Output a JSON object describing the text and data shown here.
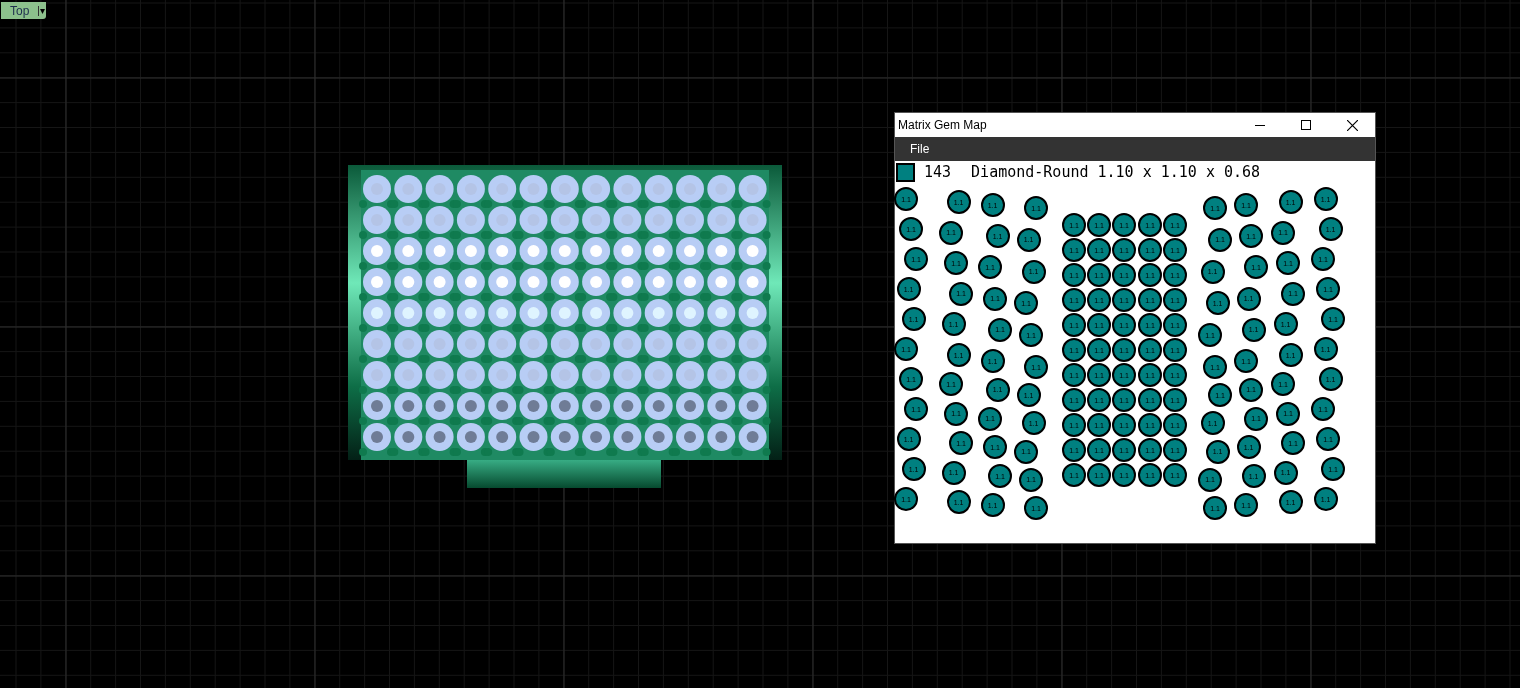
{
  "viewport": {
    "view_menu": {
      "label": "Top",
      "arrow": "▾"
    }
  },
  "window": {
    "title": "Matrix Gem Map",
    "menu": [
      "File"
    ],
    "legend": [
      {
        "color": "#008080",
        "count": "143",
        "label": "Diamond-Round 1.10 x 1.10 x 0.68"
      }
    ],
    "gems": [
      "1.1",
      "1.1",
      "1.1",
      "1.1",
      "1.1",
      "1.1",
      "1.1",
      "1.1",
      "1.1",
      "1.1",
      "1.1",
      "1.1",
      "1.1",
      "1.1",
      "1.1",
      "1.1",
      "1.1",
      "1.1",
      "1.1",
      "1.1",
      "1.1",
      "1.1",
      "1.1",
      "1.1",
      "1.1",
      "1.1",
      "1.1",
      "1.1",
      "1.1",
      "1.1",
      "1.1",
      "1.1",
      "1.1",
      "1.1",
      "1.1",
      "1.1",
      "1.1",
      "1.1",
      "1.1",
      "1.1",
      "1.1",
      "1.1",
      "1.1",
      "1.1",
      "1.1",
      "1.1",
      "1.1",
      "1.1",
      "1.1",
      "1.1",
      "1.1",
      "1.1",
      "1.1",
      "1.1",
      "1.1",
      "1.1",
      "1.1",
      "1.1",
      "1.1",
      "1.1",
      "1.1",
      "1.1",
      "1.1",
      "1.1",
      "1.1",
      "1.1",
      "1.1",
      "1.1",
      "1.1",
      "1.1",
      "1.1",
      "1.1",
      "1.1",
      "1.1",
      "1.1",
      "1.1",
      "1.1",
      "1.1",
      "1.1",
      "1.1",
      "1.1",
      "1.1",
      "1.1",
      "1.1",
      "1.1",
      "1.1",
      "1.1",
      "1.1",
      "1.1",
      "1.1",
      "1.1",
      "1.1",
      "1.1",
      "1.1",
      "1.1",
      "1.1",
      "1.1",
      "1.1",
      "1.1",
      "1.1",
      "1.1",
      "1.1",
      "1.1",
      "1.1",
      "1.1",
      "1.1",
      "1.1",
      "1.1",
      "1.1",
      "1.1",
      "1.1",
      "1.1",
      "1.1",
      "1.1",
      "1.1",
      "1.1",
      "1.1",
      "1.1",
      "1.1",
      "1.1",
      "1.1",
      "1.1",
      "1.1",
      "1.1",
      "1.1",
      "1.1",
      "1.1",
      "1.1",
      "1.1",
      "1.1",
      "1.1",
      "1.1",
      "1.1",
      "1.1",
      "1.1",
      "1.1",
      "1.1",
      "1.1",
      "1.1",
      "1.1",
      "1.1",
      "1.1",
      "1.1"
    ]
  }
}
